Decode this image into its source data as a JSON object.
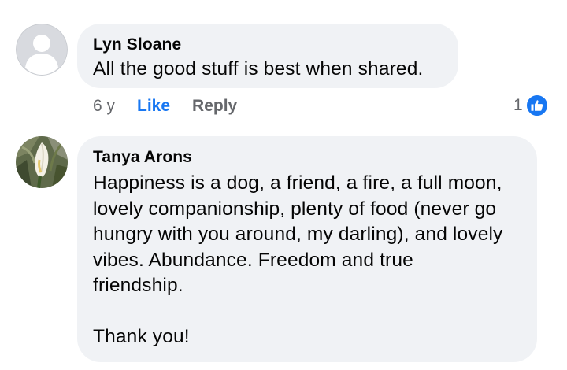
{
  "comments": [
    {
      "author": "Lyn Sloane",
      "avatar_icon": "default-user-avatar-icon",
      "text_lines": [
        "All the good stuff is best when shared."
      ],
      "time": "6 y",
      "like_label": "Like",
      "reply_label": "Reply",
      "reaction_count": "1",
      "reaction_icon": "thumbs-up-icon"
    },
    {
      "author": "Tanya Arons",
      "avatar_icon": "calla-lily-avatar",
      "text_lines": [
        "Happiness is a dog, a friend, a fire, a full moon,",
        "lovely companionship, plenty of food (never go",
        "hungry with you around, my darling), and lovely",
        "vibes.  Abundance.  Freedom and true",
        "friendship.",
        "",
        "Thank you!"
      ]
    }
  ],
  "colors": {
    "bubble": "#f0f2f5",
    "link_blue": "#1877f2",
    "meta_gray": "#65676b",
    "text": "#050505"
  }
}
